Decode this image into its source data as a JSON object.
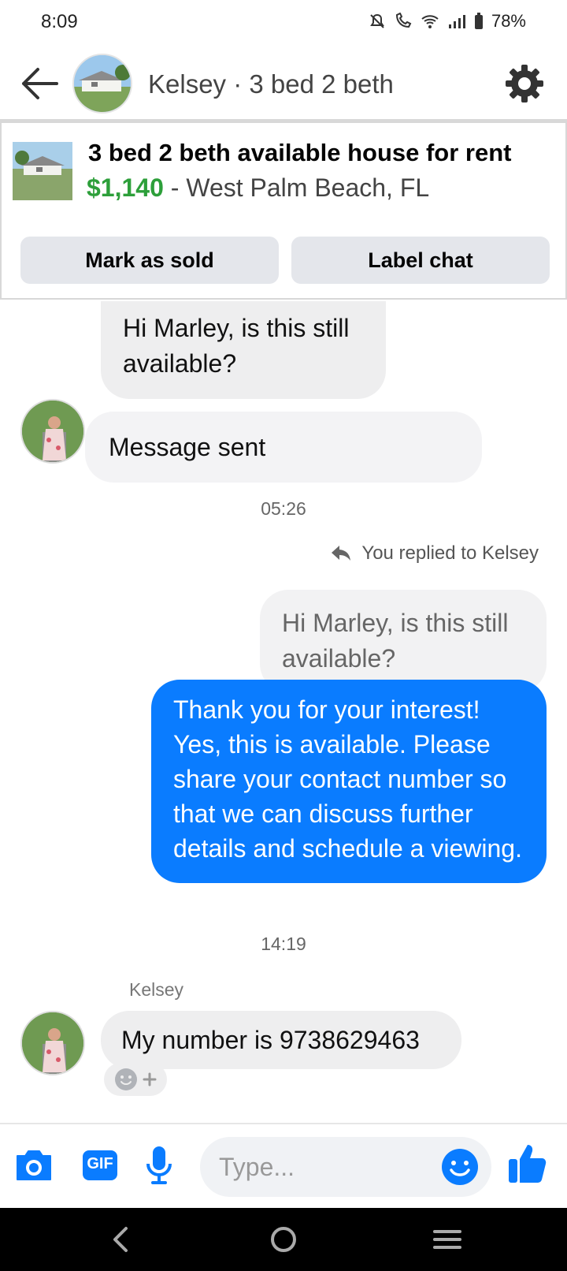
{
  "status": {
    "time": "8:09",
    "battery": "78%"
  },
  "header": {
    "title": "Kelsey · 3 bed 2 beth"
  },
  "listing": {
    "title": "3 bed 2 beth available house for rent",
    "price": "$1,140",
    "location": " - West Palm Beach, FL",
    "mark_sold_label": "Mark as sold",
    "label_chat_label": "Label chat"
  },
  "messages": {
    "in1": "Hi Marley, is this still available?",
    "in2": "Message sent",
    "time1": "05:26",
    "replied_to": "You replied to Kelsey",
    "quoted": "Hi Marley, is this still available?",
    "out1": "Thank you for your interest! Yes, this is available. Please share your contact number so that we can discuss further details and schedule a viewing.",
    "time2": "14:19",
    "sender": "Kelsey",
    "in3": "My number is 9738629463"
  },
  "composer": {
    "placeholder": "Type...",
    "gif_label": "GIF"
  },
  "colors": {
    "accent": "#0a7cff",
    "price_green": "#2d9f3a",
    "incoming_bubble": "#eeeeef"
  }
}
